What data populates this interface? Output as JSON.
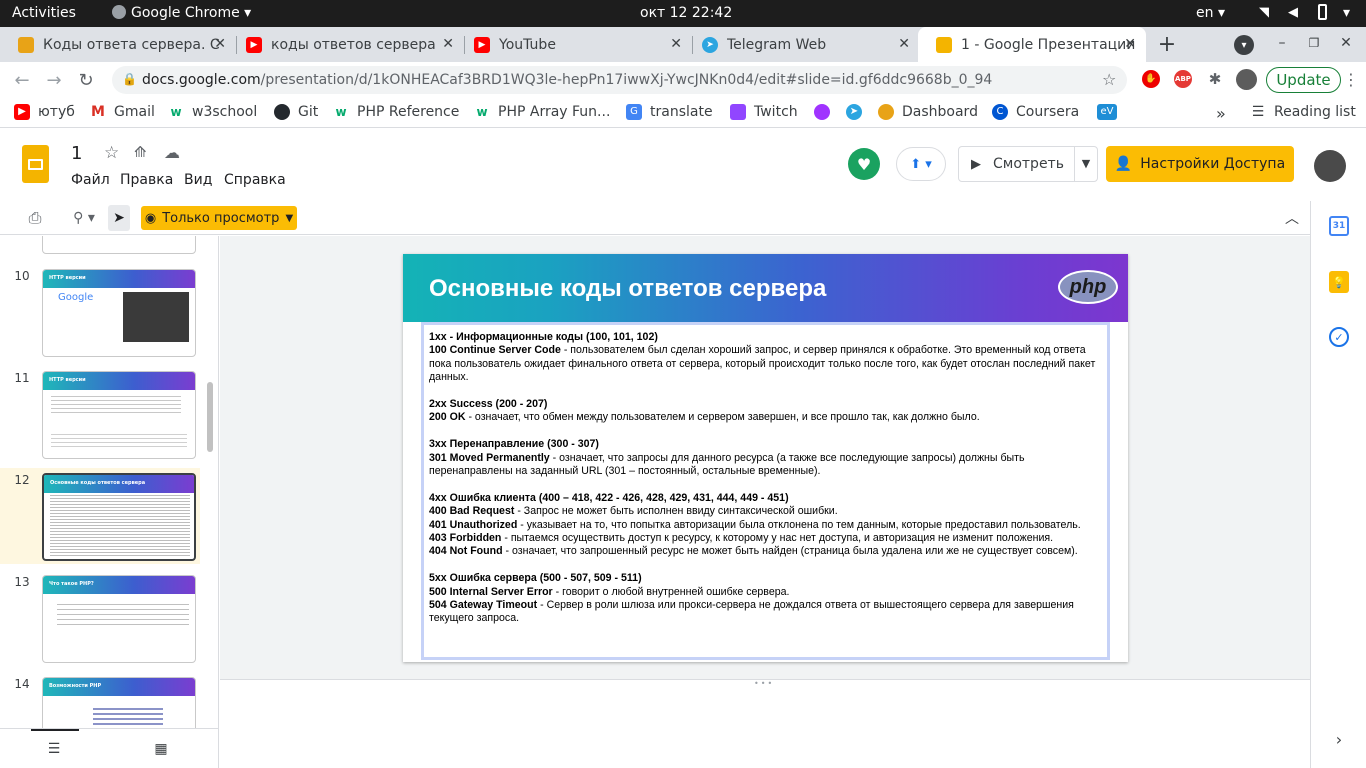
{
  "system_bar": {
    "activities": "Activities",
    "app": "Google Chrome",
    "datetime": "окт 12  22:42",
    "lang": "en"
  },
  "tabs": [
    {
      "title": "Коды ответа сервера. С",
      "fav_color": "#e8a317"
    },
    {
      "title": "коды ответов сервера",
      "fav_color": "#ff0000"
    },
    {
      "title": "YouTube",
      "fav_color": "#ff0000"
    },
    {
      "title": "Telegram Web",
      "fav_color": "#2ca5e0"
    },
    {
      "title": "1 - Google Презентации",
      "fav_color": "#f4b400"
    }
  ],
  "address": {
    "host": "docs.google.com",
    "path": "/presentation/d/1kONHEACaf3BRD1WQ3le-hepPn17iwwXj-YwcJNKn0d4/edit#slide=id.gf6ddc9668b_0_94",
    "update_label": "Update"
  },
  "bookmarks": [
    {
      "label": "ютуб",
      "color": "#ff0000"
    },
    {
      "label": "Gmail",
      "color": "#d93025"
    },
    {
      "label": "w3school",
      "color": "#04aa6d"
    },
    {
      "label": "Git",
      "color": "#24292e"
    },
    {
      "label": "PHP Reference",
      "color": "#04aa6d"
    },
    {
      "label": "PHP Array Fun...",
      "color": "#04aa6d"
    },
    {
      "label": "translate",
      "color": "#4285f4"
    },
    {
      "label": "Twitch",
      "color": "#9146ff"
    },
    {
      "label": "",
      "color": "#a033ff"
    },
    {
      "label": "",
      "color": "#2ca5e0"
    },
    {
      "label": "Dashboard",
      "color": "#e8a317"
    },
    {
      "label": "Coursera",
      "color": "#0056d2"
    },
    {
      "label": "eV",
      "color": "#1e8ed6"
    }
  ],
  "reading_list": "Reading list",
  "doc": {
    "title": "1",
    "menu": [
      "Файл",
      "Правка",
      "Вид",
      "Справка"
    ],
    "present_label": "Смотреть",
    "share_label": "Настройки Доступа",
    "view_mode": "Только просмотр"
  },
  "filmstrip": [
    {
      "num": "10",
      "title": "HTTP версии"
    },
    {
      "num": "11",
      "title": "HTTP версии"
    },
    {
      "num": "12",
      "title": "Основные коды ответов сервера"
    },
    {
      "num": "13",
      "title": "Что такое PHP?"
    },
    {
      "num": "14",
      "title": "Возможности PHP"
    }
  ],
  "slide": {
    "title": "Основные коды ответов сервера",
    "logo": "php",
    "lines": [
      {
        "b": "1xx - Информационные коды (100, 101, 102)",
        "t": ""
      },
      {
        "b": "100 Continue Server Code",
        "t": " - пользователем был сделан хороший запрос, и сервер принялся к обработке. Это временный код ответа пока пользователь ожидает финального ответа от сервера, который происходит только после того, как будет отослан последний пакет данных."
      },
      {
        "gap": true
      },
      {
        "b": "2xx Success (200 - 207)",
        "t": ""
      },
      {
        "b": "200 OK",
        "t": " - означает, что обмен между пользователем и сервером завершен, и все прошло так, как должно было."
      },
      {
        "gap": true
      },
      {
        "b": "3xx Перенаправление (300 - 307)",
        "t": ""
      },
      {
        "b": "301 Moved Permanently",
        "t": " - означает, что запросы для данного ресурса (а также все последующие запросы) должны быть перенаправлены на заданный URL (301 – постоянный, остальные временные)."
      },
      {
        "gap": true
      },
      {
        "b": "4xx Ошибка клиента (400 – 418, 422 - 426, 428, 429, 431, 444, 449 - 451)",
        "t": ""
      },
      {
        "b": "400 Bad Request",
        "t": " - Запрос не может быть исполнен ввиду синтаксической ошибки."
      },
      {
        "b": "401 Unauthorized",
        "t": " - указывает на то, что попытка авторизации была отклонена по тем данным, которые предоставил пользователь."
      },
      {
        "b": "403 Forbidden",
        "t": " - пытаемся осуществить доступ к ресурсу, к которому у нас нет доступа, и авторизация не изменит положения."
      },
      {
        "b": "404 Not Found",
        "t": " - означает, что запрошенный ресурс не может быть найден (страница была удалена или же не существует совсем)."
      },
      {
        "gap": true
      },
      {
        "b": "5xx Ошибка сервера (500 - 507, 509 - 511)",
        "t": ""
      },
      {
        "b": "500 Internal Server Error",
        "t": " - говорит о любой внутренней ошибке сервера."
      },
      {
        "b": "504 Gateway Timeout",
        "t": " - Сервер в роли шлюза или прокси-сервера не дождался ответа от вышестоящего сервера для завершения текущего запроса."
      }
    ]
  },
  "colors": {
    "accent": "#fbbc04",
    "share_bg": "#fbbc04",
    "update": "#188038"
  }
}
